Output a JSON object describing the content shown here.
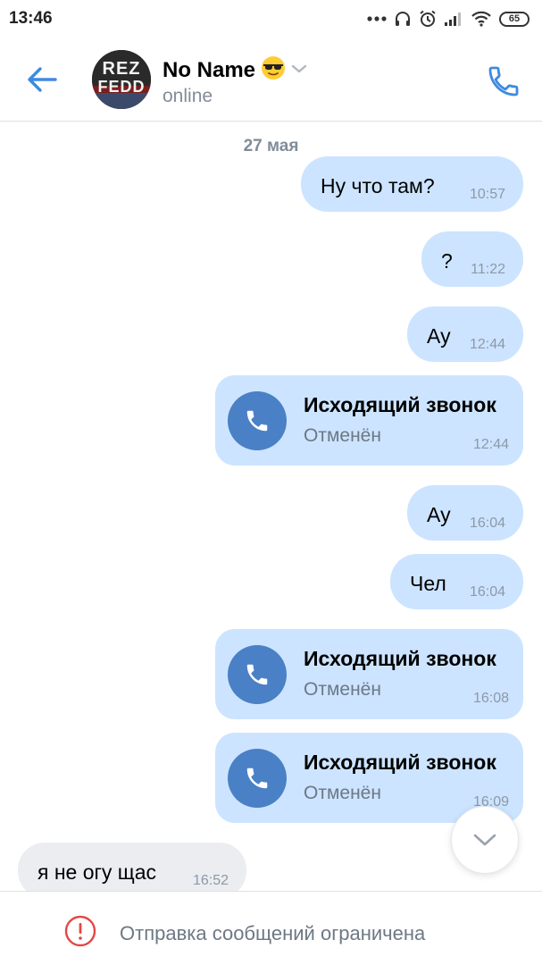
{
  "status_bar": {
    "time": "13:46",
    "battery": "65",
    "icons": [
      "more-dots-icon",
      "headphones-icon",
      "alarm-icon",
      "signal-icon",
      "wifi-icon",
      "battery-icon"
    ]
  },
  "header": {
    "contact_name": "No Name",
    "contact_emoji": "sunglasses-emoji",
    "status": "online",
    "avatar_text_1": "REZ",
    "avatar_text_2": "FEDD"
  },
  "chat": {
    "date": "27 мая",
    "messages": [
      {
        "type": "text",
        "direction": "out",
        "text": "Ну что там?",
        "time": "10:57"
      },
      {
        "type": "text",
        "direction": "out",
        "text": "?",
        "time": "11:22"
      },
      {
        "type": "text",
        "direction": "out",
        "text": "Ау",
        "time": "12:44"
      },
      {
        "type": "call",
        "direction": "out",
        "title": "Исходящий звонок",
        "sub": "Отменён",
        "time": "12:44"
      },
      {
        "type": "text",
        "direction": "out",
        "text": "Ау",
        "time": "16:04"
      },
      {
        "type": "text",
        "direction": "out",
        "text": "Чел",
        "time": "16:04"
      },
      {
        "type": "call",
        "direction": "out",
        "title": "Исходящий звонок",
        "sub": "Отменён",
        "time": "16:08"
      },
      {
        "type": "call",
        "direction": "out",
        "title": "Исходящий звонок",
        "sub": "Отменён",
        "time": "16:09"
      },
      {
        "type": "text",
        "direction": "in",
        "text": "я не огу щас",
        "time": "16:52"
      }
    ]
  },
  "bottom": {
    "restriction_text": "Отправка сообщений ограничена"
  },
  "colors": {
    "accent": "#3f8ae0",
    "bubble_out": "#cce4ff",
    "bubble_in": "#ebedf0",
    "call_circle": "#4a80c5",
    "warning_red": "#e64646"
  }
}
